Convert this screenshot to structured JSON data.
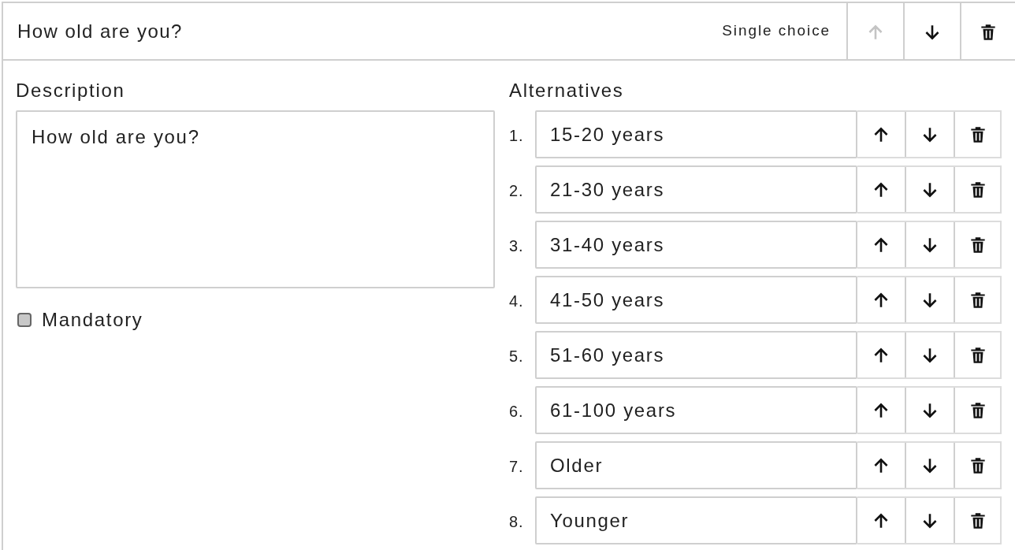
{
  "question": {
    "title": "How old are you?",
    "type_label": "Single choice",
    "move_up_disabled": true,
    "move_down_disabled": false
  },
  "description": {
    "label": "Description",
    "value": "How old are you?"
  },
  "mandatory": {
    "label": "Mandatory",
    "checked": false
  },
  "alternatives": {
    "label": "Alternatives",
    "items": [
      {
        "number": "1.",
        "value": "15-20 years"
      },
      {
        "number": "2.",
        "value": "21-30 years"
      },
      {
        "number": "3.",
        "value": "31-40 years"
      },
      {
        "number": "4.",
        "value": "41-50 years"
      },
      {
        "number": "5.",
        "value": "51-60 years"
      },
      {
        "number": "6.",
        "value": "61-100 years"
      },
      {
        "number": "7.",
        "value": "Older"
      },
      {
        "number": "8.",
        "value": "Younger"
      }
    ]
  }
}
